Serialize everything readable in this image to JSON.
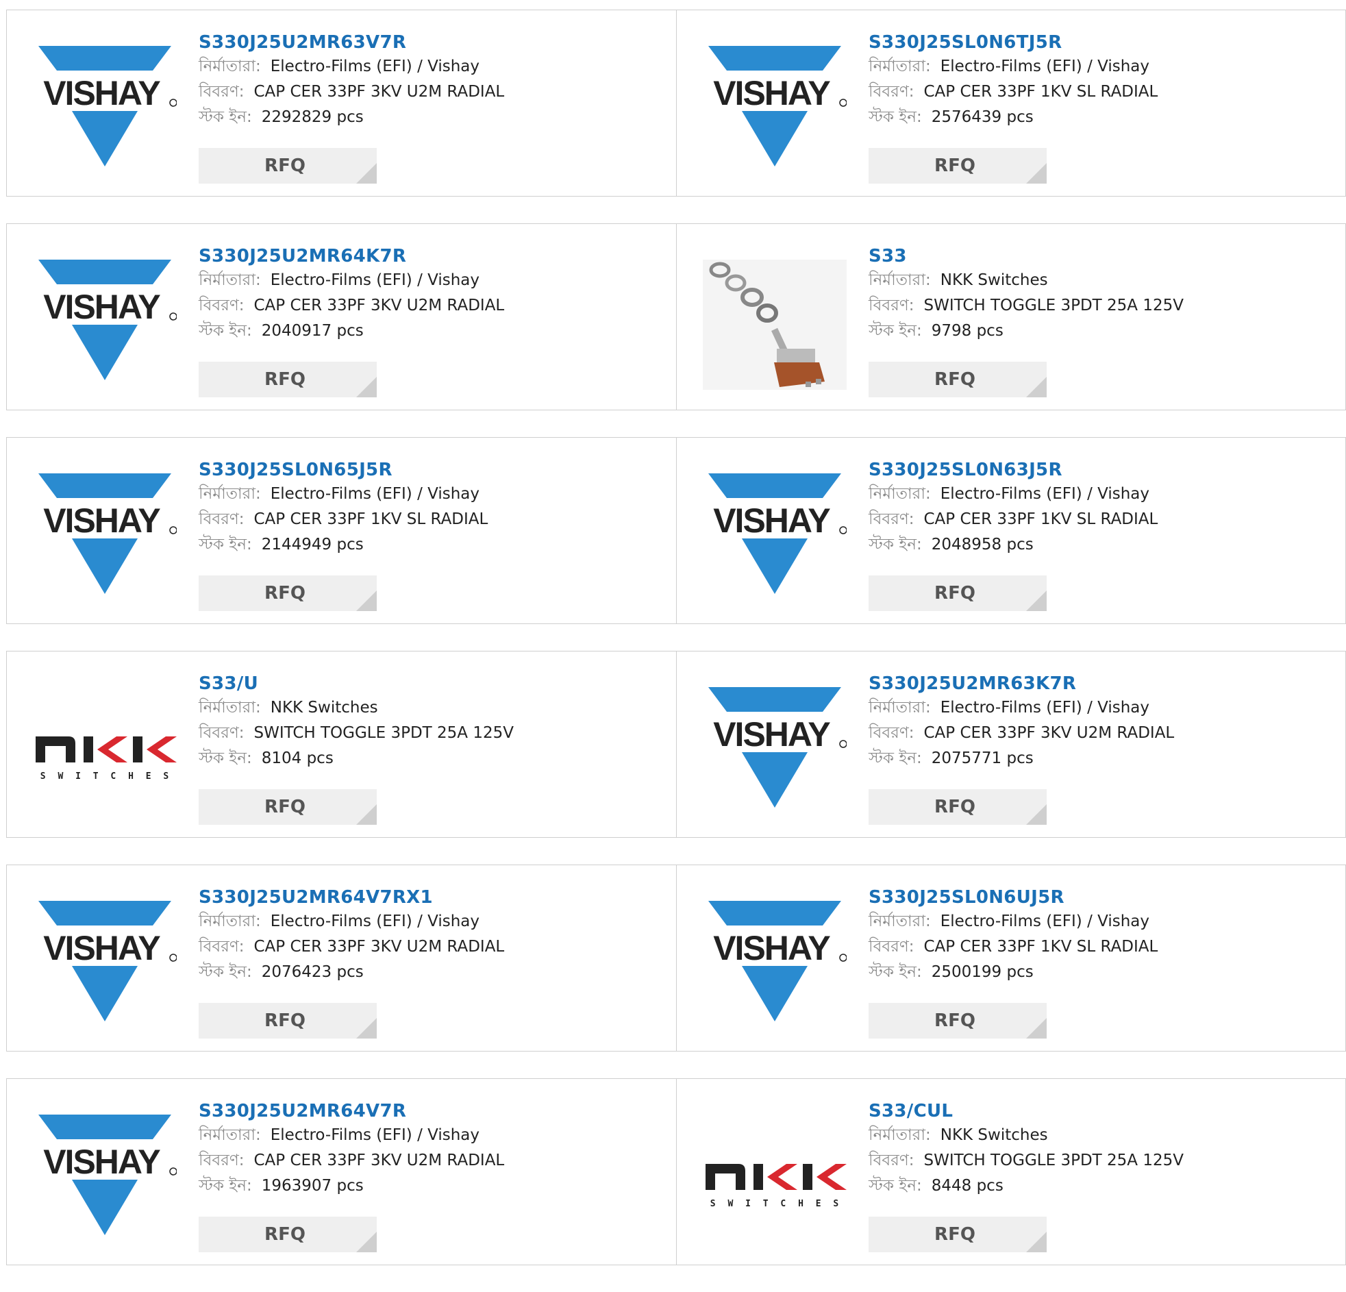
{
  "labels": {
    "manufacturer": "নির্মাতারা:",
    "description": "বিবরণ:",
    "stock": "স্টক ইন:",
    "rfq": "RFQ"
  },
  "colors": {
    "part_link": "#1a6fb5",
    "vishay_blue": "#2a8bd0",
    "nkk_red": "#d9282f"
  },
  "products": [
    {
      "part": "S330J25U2MR63V7R",
      "logo": "vishay-logo",
      "manufacturer": "Electro-Films (EFI) / Vishay",
      "description": "CAP CER 33PF 3KV U2M RADIAL",
      "stock": "2292829 pcs"
    },
    {
      "part": "S330J25SL0N6TJ5R",
      "logo": "vishay-logo",
      "manufacturer": "Electro-Films (EFI) / Vishay",
      "description": "CAP CER 33PF 1KV SL RADIAL",
      "stock": "2576439 pcs"
    },
    {
      "part": "S330J25U2MR64K7R",
      "logo": "vishay-logo",
      "manufacturer": "Electro-Films (EFI) / Vishay",
      "description": "CAP CER 33PF 3KV U2M RADIAL",
      "stock": "2040917 pcs"
    },
    {
      "part": "S33",
      "logo": "toggle-switch-photo",
      "manufacturer": "NKK Switches",
      "description": "SWITCH TOGGLE 3PDT 25A 125V",
      "stock": "9798 pcs"
    },
    {
      "part": "S330J25SL0N65J5R",
      "logo": "vishay-logo",
      "manufacturer": "Electro-Films (EFI) / Vishay",
      "description": "CAP CER 33PF 1KV SL RADIAL",
      "stock": "2144949 pcs"
    },
    {
      "part": "S330J25SL0N63J5R",
      "logo": "vishay-logo",
      "manufacturer": "Electro-Films (EFI) / Vishay",
      "description": "CAP CER 33PF 1KV SL RADIAL",
      "stock": "2048958 pcs"
    },
    {
      "part": "S33/U",
      "logo": "nkk-logo",
      "manufacturer": "NKK Switches",
      "description": "SWITCH TOGGLE 3PDT 25A 125V",
      "stock": "8104 pcs"
    },
    {
      "part": "S330J25U2MR63K7R",
      "logo": "vishay-logo",
      "manufacturer": "Electro-Films (EFI) / Vishay",
      "description": "CAP CER 33PF 3KV U2M RADIAL",
      "stock": "2075771 pcs"
    },
    {
      "part": "S330J25U2MR64V7RX1",
      "logo": "vishay-logo",
      "manufacturer": "Electro-Films (EFI) / Vishay",
      "description": "CAP CER 33PF 3KV U2M RADIAL",
      "stock": "2076423 pcs"
    },
    {
      "part": "S330J25SL0N6UJ5R",
      "logo": "vishay-logo",
      "manufacturer": "Electro-Films (EFI) / Vishay",
      "description": "CAP CER 33PF 1KV SL RADIAL",
      "stock": "2500199 pcs"
    },
    {
      "part": "S330J25U2MR64V7R",
      "logo": "vishay-logo",
      "manufacturer": "Electro-Films (EFI) / Vishay",
      "description": "CAP CER 33PF 3KV U2M RADIAL",
      "stock": "1963907 pcs"
    },
    {
      "part": "S33/CUL",
      "logo": "nkk-logo",
      "manufacturer": "NKK Switches",
      "description": "SWITCH TOGGLE 3PDT 25A 125V",
      "stock": "8448 pcs"
    }
  ],
  "logo_text": {
    "vishay": "VISHAY",
    "nkk_sub": "SWITCHES"
  }
}
